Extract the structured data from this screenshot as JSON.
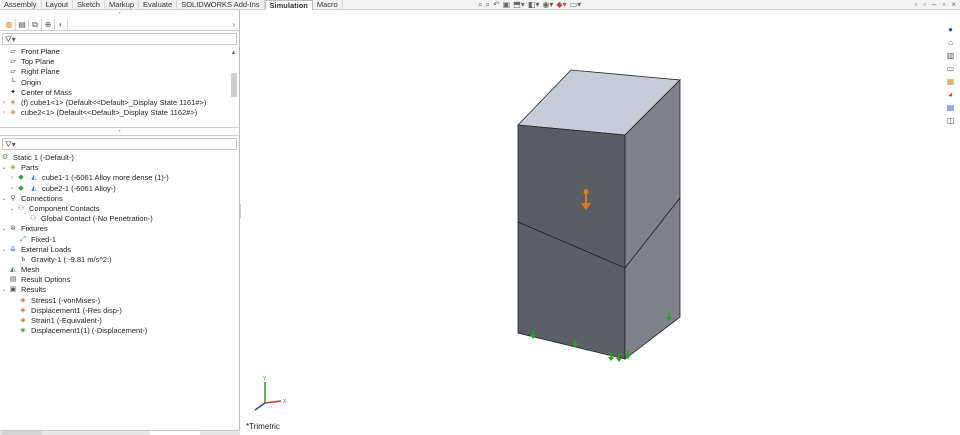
{
  "commandmanager": {
    "tabs": [
      "Assembly",
      "Layout",
      "Sketch",
      "Markup",
      "Evaluate",
      "SOLIDWORKS Add-Ins",
      "Simulation",
      "Macro"
    ],
    "active_tab": "Simulation"
  },
  "headsup_icons": [
    "zoom-fit-icon",
    "zoom-area-icon",
    "previous-view-icon",
    "section-view-icon",
    "view-orientation-icon",
    "display-style-icon",
    "hide-show-icon",
    "appearance-icon",
    "scene-icon"
  ],
  "feature_tree": {
    "filter_placeholder": "",
    "items": [
      {
        "label": "Front Plane",
        "icon": "plane-icon"
      },
      {
        "label": "Top Plane",
        "icon": "plane-icon"
      },
      {
        "label": "Right Plane",
        "icon": "plane-icon"
      },
      {
        "label": "Origin",
        "icon": "origin-icon"
      },
      {
        "label": "Center of Mass",
        "icon": "center-of-mass-icon"
      },
      {
        "label": "(f) cube1<1> (Default<<Default>_Display State 1161#>)",
        "icon": "part-icon"
      },
      {
        "label": "cube2<1> (Default<<Default>_Display State 1162#>)",
        "icon": "part-icon"
      }
    ]
  },
  "sim_tree": {
    "study": "Static 1 (-Default-)",
    "parts_label": "Parts",
    "parts": [
      "cube1-1 (-6061 Alloy more dense (1)-)",
      "cube2-1 (-6061 Alloy-)"
    ],
    "connections_label": "Connections",
    "component_contacts": "Component Contacts",
    "global_contact": "Global Contact (-No Penetration-)",
    "fixtures_label": "Fixtures",
    "fixed": "Fixed-1",
    "external_loads_label": "External Loads",
    "gravity": "Gravity-1 (:-9.81 m/s^2:)",
    "mesh": "Mesh",
    "result_options": "Result Options",
    "results_label": "Results",
    "results": [
      "Stress1 (-vonMises-)",
      "Displacement1 (-Res disp-)",
      "Strain1 (-Equivalent-)",
      "Displacement1(1) (-Displacement-)"
    ]
  },
  "viewport": {
    "view_name": "*Trimetric"
  },
  "colors": {
    "accent": "#d86b15",
    "cube_front": "#5b5d65",
    "cube_side": "#80828a",
    "cube_top": "#c8ccd8",
    "fixture": "#1fa51f",
    "load_arrow": "#e07b1a"
  }
}
